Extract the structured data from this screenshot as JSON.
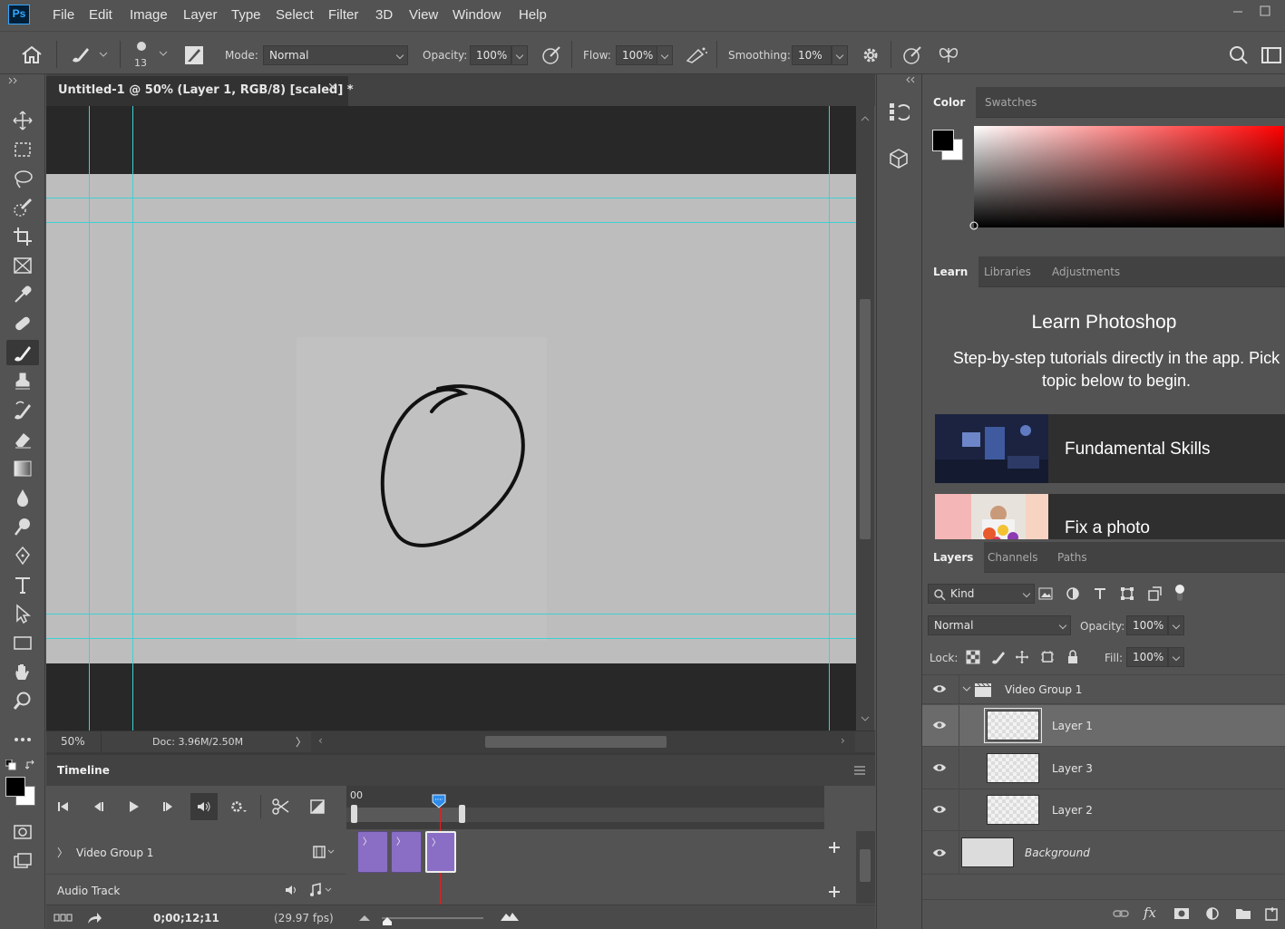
{
  "app": {
    "logo": "Ps"
  },
  "menu": [
    "File",
    "Edit",
    "Image",
    "Layer",
    "Type",
    "Select",
    "Filter",
    "3D",
    "View",
    "Window",
    "Help"
  ],
  "options": {
    "brush_size": "13",
    "mode_label": "Mode:",
    "mode_value": "Normal",
    "opacity_label": "Opacity:",
    "opacity_value": "100%",
    "flow_label": "Flow:",
    "flow_value": "100%",
    "smoothing_label": "Smoothing:",
    "smoothing_value": "10%"
  },
  "document": {
    "tab_title": "Untitled-1 @ 50% (Layer 1, RGB/8) [scaled] *",
    "zoom": "50%",
    "doc_size": "Doc: 3.96M/2.50M"
  },
  "timeline": {
    "title": "Timeline",
    "ruler_start": "00",
    "video_group": "Video Group 1",
    "audio_track": "Audio Track",
    "timecode": "0;00;12;11",
    "fps": "(29.97 fps)",
    "clip_count": 3
  },
  "color_panel": {
    "tabs": [
      "Color",
      "Swatches"
    ],
    "hue_color": "#ff0000"
  },
  "learn_panel": {
    "tabs": [
      "Learn",
      "Libraries",
      "Adjustments"
    ],
    "title": "Learn Photoshop",
    "subtitle": "Step-by-step tutorials directly in the app. Pick topic below to begin.",
    "cards": [
      "Fundamental Skills",
      "Fix a photo"
    ]
  },
  "layers_panel": {
    "tabs": [
      "Layers",
      "Channels",
      "Paths"
    ],
    "filter_kind": "Kind",
    "blend_mode": "Normal",
    "opacity_label": "Opacity:",
    "opacity_value": "100%",
    "lock_label": "Lock:",
    "fill_label": "Fill:",
    "fill_value": "100%",
    "group_name": "Video Group 1",
    "layers": [
      "Layer 1",
      "Layer 3",
      "Layer 2"
    ],
    "background": "Background"
  },
  "colors": {
    "accent": "#31a8ff",
    "guide": "#3fd0d4",
    "clip": "#8a6ec5",
    "playhead": "#e02020"
  }
}
